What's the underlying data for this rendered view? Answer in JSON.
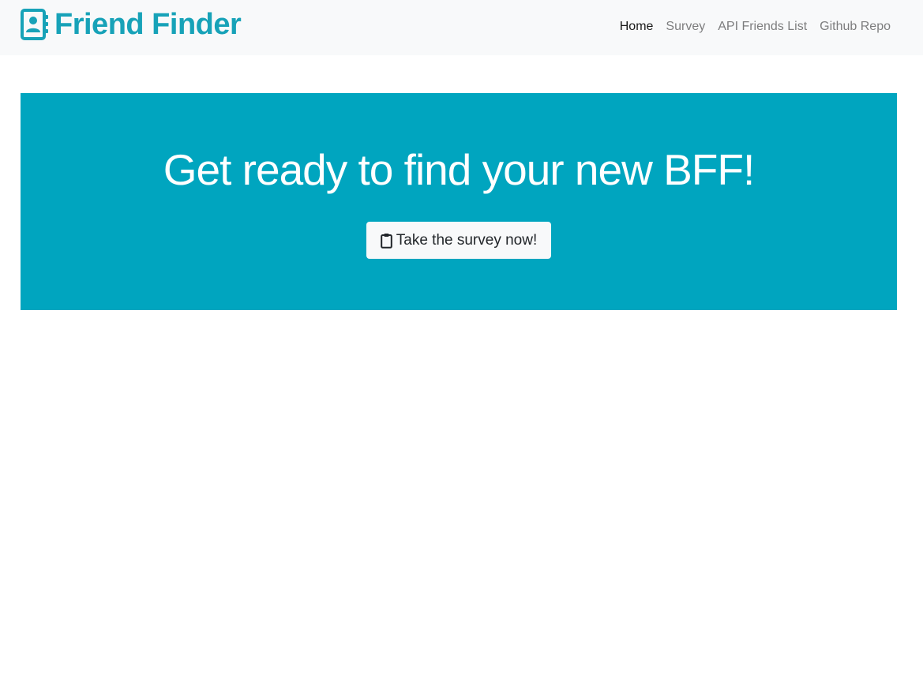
{
  "navbar": {
    "brand_label": "Friend Finder",
    "brand_icon": "address-book-icon",
    "links": [
      {
        "label": "Home",
        "active": true
      },
      {
        "label": "Survey",
        "active": false
      },
      {
        "label": "API Friends List",
        "active": false
      },
      {
        "label": "Github Repo",
        "active": false
      }
    ]
  },
  "hero": {
    "title": "Get ready to find your new BFF!",
    "button_label": "Take the survey now!",
    "button_icon": "clipboard-icon"
  },
  "colors": {
    "brand": "#17a2b8",
    "hero_background": "#00a5bf",
    "navbar_background": "#f8f9fa",
    "button_background": "#f8f9fa"
  }
}
